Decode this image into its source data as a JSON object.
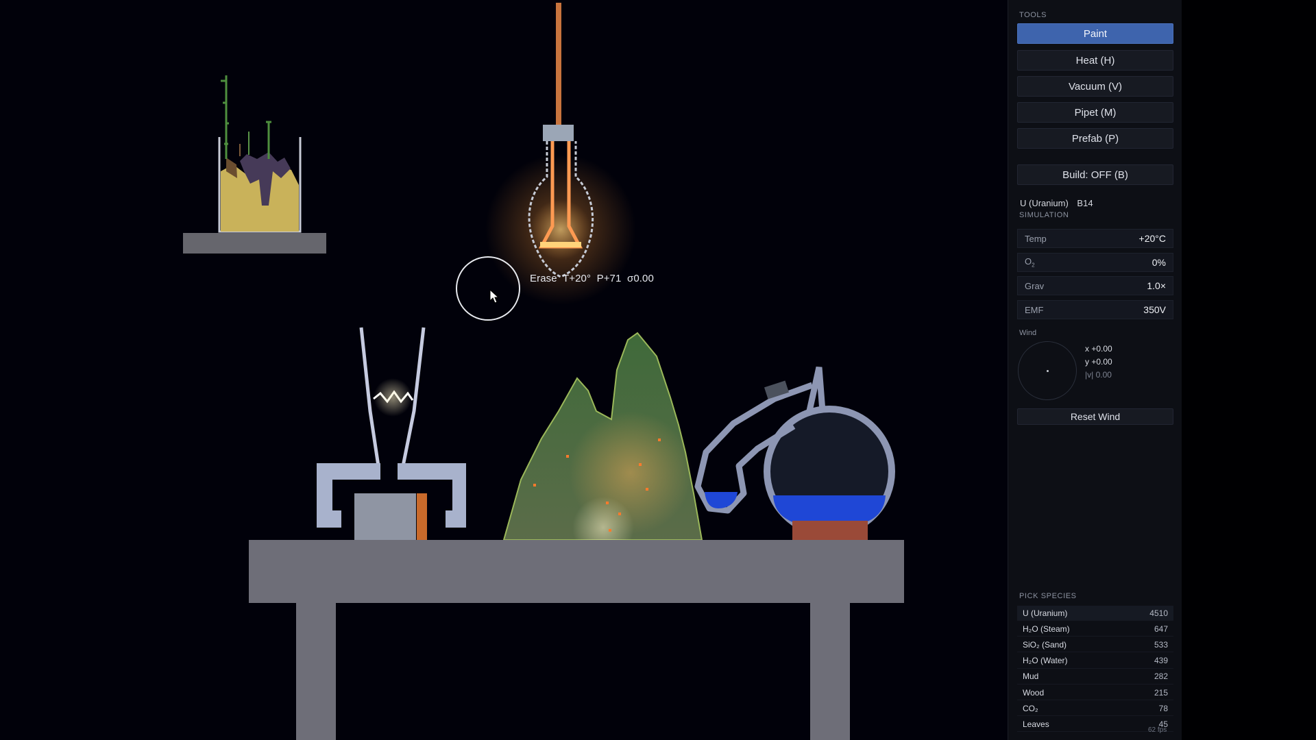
{
  "hover_readout": "Erase  T+20°  P+71  σ0.00",
  "tools": {
    "label": "TOOLS",
    "buttons": [
      {
        "label": "Paint",
        "active": true
      },
      {
        "label": "Heat  (H)"
      },
      {
        "label": "Vacuum  (V)"
      },
      {
        "label": "Pipet  (M)"
      },
      {
        "label": "Prefab  (P)"
      }
    ],
    "build_label": "Build: OFF  (B)"
  },
  "selected_element": {
    "name": "U (Uranium)",
    "code": "B14"
  },
  "simulation": {
    "label": "SIMULATION",
    "temp": {
      "key": "Temp",
      "value": "+20°C"
    },
    "o2": {
      "key": "O",
      "sub": "2",
      "value": "0%"
    },
    "grav": {
      "key": "Grav",
      "value": "1.0×"
    },
    "emf": {
      "key": "EMF",
      "value": "350V"
    }
  },
  "wind": {
    "label": "Wind",
    "x": "x +0.00",
    "y": "y +0.00",
    "mag": "|v| 0.00",
    "reset_label": "Reset Wind"
  },
  "species": {
    "label": "PICK SPECIES",
    "rows": [
      {
        "name": "U (Uranium)",
        "count": "4510"
      },
      {
        "name": "H₂O (Steam)",
        "count": "647"
      },
      {
        "name": "SiO₂ (Sand)",
        "count": "533"
      },
      {
        "name": "H₂O (Water)",
        "count": "439"
      },
      {
        "name": "Mud",
        "count": "282"
      },
      {
        "name": "Wood",
        "count": "215"
      },
      {
        "name": "CO₂",
        "count": "78"
      },
      {
        "name": "Leaves",
        "count": "45"
      }
    ]
  },
  "fps": "62 fps",
  "colors": {
    "accent": "#3e64ad",
    "panel_bg": "#0d0f15",
    "stone": "#6e6e78",
    "water": "#1f47d6",
    "fire_glow": "#ffb35a",
    "plant": "#4c6b3c"
  }
}
